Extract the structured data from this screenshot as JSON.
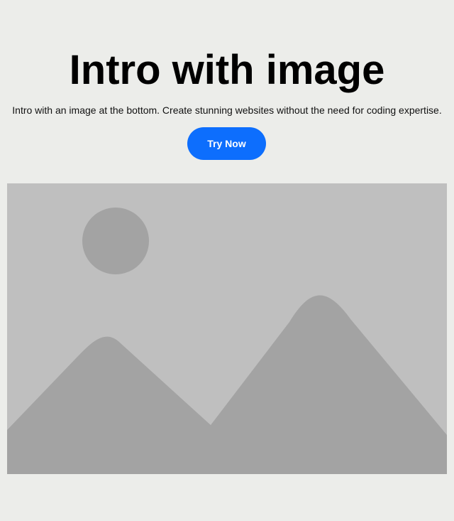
{
  "hero": {
    "title": "Intro with image",
    "subtitle": "Intro with an image at the bottom. Create stunning websites without the need for coding expertise.",
    "cta_label": "Try Now"
  },
  "image": {
    "icon": "image-placeholder-icon",
    "background_color": "#bfbfbf",
    "shape_color": "#a3a3a3"
  },
  "colors": {
    "page_background": "#ecedea",
    "accent": "#0d6efd"
  }
}
